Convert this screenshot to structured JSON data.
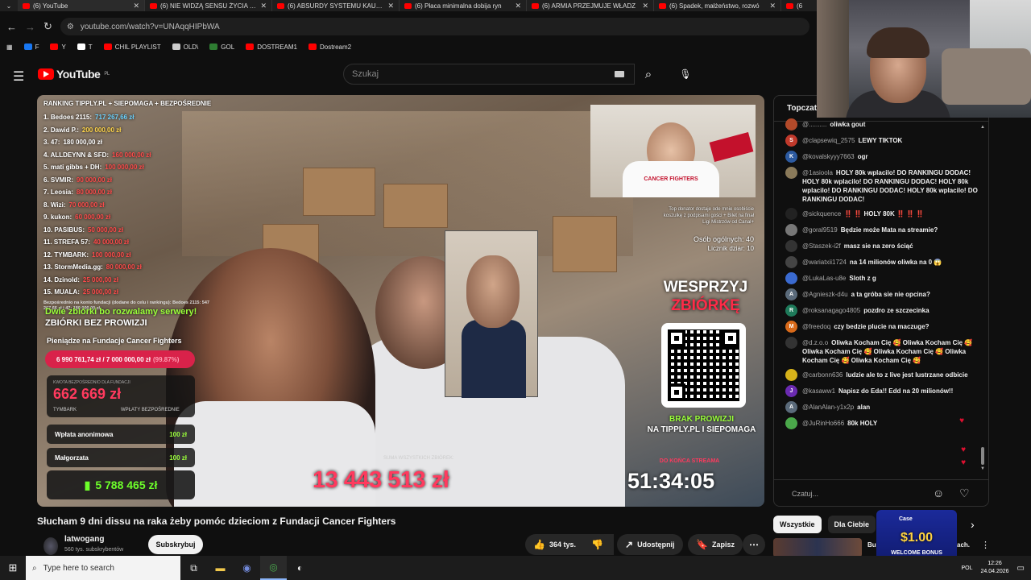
{
  "tabs": [
    {
      "title": "(6) YouTube",
      "active": true
    },
    {
      "title": "(6) NIE WIDZĄ SENSU ŻYCIA - C"
    },
    {
      "title": "(6) ABSURDY SYSTEMU KAUCY"
    },
    {
      "title": "(6) Płaca minimalna dobija ryn"
    },
    {
      "title": "(6) ARMIA PRZEJMUJE WŁADZ"
    },
    {
      "title": "(6) Spadek, małżeństwo, rozwó"
    },
    {
      "title": "(6"
    }
  ],
  "address": {
    "url": "youtube.com/watch?v=UNAqqHIPbWA"
  },
  "bookmarks": [
    {
      "label": "F",
      "color": "#1877f2",
      "icon": "facebook-icon"
    },
    {
      "label": "Y",
      "color": "#ff0000",
      "icon": "youtube-icon"
    },
    {
      "label": "T",
      "color": "#ffffff",
      "icon": "x-icon"
    },
    {
      "label": "CHIL PLAYLIST",
      "color": "#ff0000",
      "icon": "youtube-icon"
    },
    {
      "label": "OLD\\",
      "color": "#cccccc",
      "icon": "folder-icon"
    },
    {
      "label": "GOL",
      "color": "#2e7d32",
      "icon": "g-icon"
    },
    {
      "label": "DOSTREAM1",
      "color": "#ff0000",
      "icon": "youtube-icon"
    },
    {
      "label": "Dostream2",
      "color": "#ff0000",
      "icon": "youtube-icon"
    }
  ],
  "youtube": {
    "logo": "YouTube",
    "region": "PL",
    "search_placeholder": "Szukaj"
  },
  "stream": {
    "ranking_title": "RANKING TIPPLY.PL + SIEPOMAGA + BEZPOŚREDNIE",
    "ranking": [
      {
        "name": "1. Bedoes 2115:",
        "amount": "717 267,66 zł",
        "color": "#6dd3ff"
      },
      {
        "name": "2. Dawid P.:",
        "amount": "200 000,00 zł",
        "color": "#ffd54a"
      },
      {
        "name": "3. 47:",
        "amount": "180 000,00 zł",
        "color": "#ffffff"
      },
      {
        "name": "4. ALLDEYNN & SFD:",
        "amount": "160 000,00 zł",
        "color": "#ff4a4a"
      },
      {
        "name": "5. mati gibbs + DH:",
        "amount": "100 000,00 zł",
        "color": "#ff4a4a"
      },
      {
        "name": "6. SVMIR:",
        "amount": "90 000,00 zł",
        "color": "#ff4a4a"
      },
      {
        "name": "7. Leosia:",
        "amount": "80 000,00 zł",
        "color": "#ff4a4a"
      },
      {
        "name": "8. Wizi:",
        "amount": "70 000,00 zł",
        "color": "#ff4a4a"
      },
      {
        "name": "9. kukon:",
        "amount": "60 000,00 zł",
        "color": "#ff4a4a"
      },
      {
        "name": "10. PASIBUS:",
        "amount": "50 000,00 zł",
        "color": "#ff4a4a"
      },
      {
        "name": "11. STREFA 57:",
        "amount": "40 000,00 zł",
        "color": "#ff4a4a"
      },
      {
        "name": "12. TYMBARK:",
        "amount": "100 000,00 zł",
        "color": "#ff4a4a"
      },
      {
        "name": "13. StormMedia.gg:",
        "amount": "80 000,00 zł",
        "color": "#ff4a4a"
      },
      {
        "name": "14. Dzinold:",
        "amount": "25 000,00 zł",
        "color": "#ff4a4a"
      },
      {
        "name": "15. MUALA:",
        "amount": "25 000,00 zł",
        "color": "#ff4a4a"
      }
    ],
    "ranking_note": "Bezpośrednio na konto fundacji (dodane do celu i rankingu): Bedoes 2115: 547 267,66 zł i 47: 180 000,00 zł",
    "promo_line1": "Dwie zbiórki bo rozwalamy serwery!",
    "promo_line2": "ZBIÓRKI BEZ PROWIZJI",
    "fund_label": "Pieniądze na Fundacje Cancer Fighters",
    "fund_progress": "6 990 761,74 zł / 7 000 000,00 zł",
    "fund_percent": "(99.87%)",
    "direct_label": "KWOTA BEZPOŚREDNIO DLA FUNDACJI",
    "direct_amount": "662 669 zł",
    "direct_sub1": "TYMBARK",
    "direct_sub2": "WPŁATY BEZPOŚREDNIE",
    "donations": [
      {
        "name": "Wpłata anonimowa",
        "amount": "100 zł"
      },
      {
        "name": "Małgorzata",
        "amount": "100 zł"
      }
    ],
    "total_tipply": "5 788 465 zł",
    "sum_all_label": "SUMA WSZYSTKICH ZBIÓREK:",
    "sum_all": "13 443 513 zł",
    "donor_note": "Top donator dostaje ode mnie osobiście koszulkę z podpisami gości + Bilet na finał Ligi Mistrzów od Canal+",
    "viewers": "Osób ogólnych: 40",
    "cuts": "Licznik dziar: 10",
    "cam_shirt": "CANCER FIGHTERS",
    "wesprzyj": "WESPRZYJ",
    "zbiorke": "ZBIÓRKĘ",
    "no_commission": "BRAK PROWIZJI",
    "at": "NA TIPPLY.PL I SIEPOMAGA",
    "until_end": "DO KOŃCA STREAMA",
    "timer": "51:34:05"
  },
  "video": {
    "title": "Słucham 9 dni dissu na raka żeby pomóc dzieciom z Fundacji Cancer Fighters",
    "channel": "latwogang",
    "subscribers": "560 tys. subskrybentów",
    "subscribe": "Subskrybuj",
    "likes": "364 tys.",
    "share": "Udostępnij",
    "save": "Zapisz"
  },
  "chat": {
    "header": "Topczat",
    "messages": [
      {
        "author": "@..........",
        "text": "oliwka gout",
        "avatar_color": "#b34a2a",
        "initial": ""
      },
      {
        "author": "@clapsewiq_2575",
        "text": "LEWY TIKTOK",
        "avatar_color": "#c0392b",
        "initial": "S"
      },
      {
        "author": "@kovalskyyy7663",
        "text": "ogr",
        "avatar_color": "#2c5aa0",
        "initial": "K"
      },
      {
        "author": "@1asioola",
        "text": "HOLY 80k wplacilo! DO RANKINGU DODAC! HOLY 80k wplacilo! DO RANKINGU DODAC! HOLY 80k wplacilo! DO RANKINGU DODAC! HOLY 80k wplacilo! DO RANKINGU DODAC!",
        "avatar_color": "#8a7a5a",
        "initial": ""
      },
      {
        "author": "@sickquence",
        "text": "‼️ ‼️ HOLY 80K ‼️ ‼️ ‼️",
        "avatar_color": "#222222",
        "initial": ""
      },
      {
        "author": "@goral9519",
        "text": "Będzie może Mata na streamie?",
        "avatar_color": "#777777",
        "initial": ""
      },
      {
        "author": "@Staszek-i2f",
        "text": "masz sie na zero ściąć",
        "avatar_color": "#333333",
        "initial": ""
      },
      {
        "author": "@wariatxii1724",
        "text": "na 14 milionów oliwka na 0 😱",
        "avatar_color": "#444444",
        "initial": ""
      },
      {
        "author": "@LukaLas-u8e",
        "text": "Sloth z g",
        "avatar_color": "#3a6ad0",
        "initial": ""
      },
      {
        "author": "@Agnieszk-d4u",
        "text": "a ta gróba sie nie opcina?",
        "avatar_color": "#5a6a7a",
        "initial": "A"
      },
      {
        "author": "@roksanagago4805",
        "text": "pozdro ze szczecinka",
        "avatar_color": "#1e7a5a",
        "initial": "R"
      },
      {
        "author": "@freedoq",
        "text": "czy bedzie plucie na maczuge?",
        "avatar_color": "#d86a1a",
        "initial": "M"
      },
      {
        "author": "@d.z.o.o",
        "text": "Oliwka Kocham Cię 🥰 Oliwka Kocham Cię 🥰 Oliwka Kocham Cię 🥰 Oliwka Kocham Cię 🥰 Oliwka Kocham Cię 🥰 Oliwka Kocham Cię 🥰",
        "avatar_color": "#333333",
        "initial": ""
      },
      {
        "author": "@carbonn636",
        "text": "ludzie ale to z live jest lustrzane odbicie",
        "avatar_color": "#d6b21a",
        "initial": ""
      },
      {
        "author": "@kasaww1",
        "text": "Napisz do Eda!! Edd na 20 milionów!!",
        "avatar_color": "#6a2ab0",
        "initial": "J"
      },
      {
        "author": "@AlanAlan-y1x2p",
        "text": "alan",
        "avatar_color": "#5a6a7a",
        "initial": "A"
      },
      {
        "author": "@JuRinHo666",
        "text": "80k HOLY",
        "avatar_color": "#4aa84a",
        "initial": ""
      }
    ],
    "input_placeholder": "Czatuj..."
  },
  "chips": [
    "Wszystkie",
    "Dla Ciebie"
  ],
  "recommendations": {
    "snip1": "Bu",
    "snip2": "ach."
  },
  "ad": {
    "brand": "Case",
    "amount": "$1.00",
    "bonus": "WELCOME BONUS"
  },
  "taskbar": {
    "search_placeholder": "Type here to search",
    "time": "12:26",
    "date": "24.04.2026",
    "lang": "POL"
  }
}
